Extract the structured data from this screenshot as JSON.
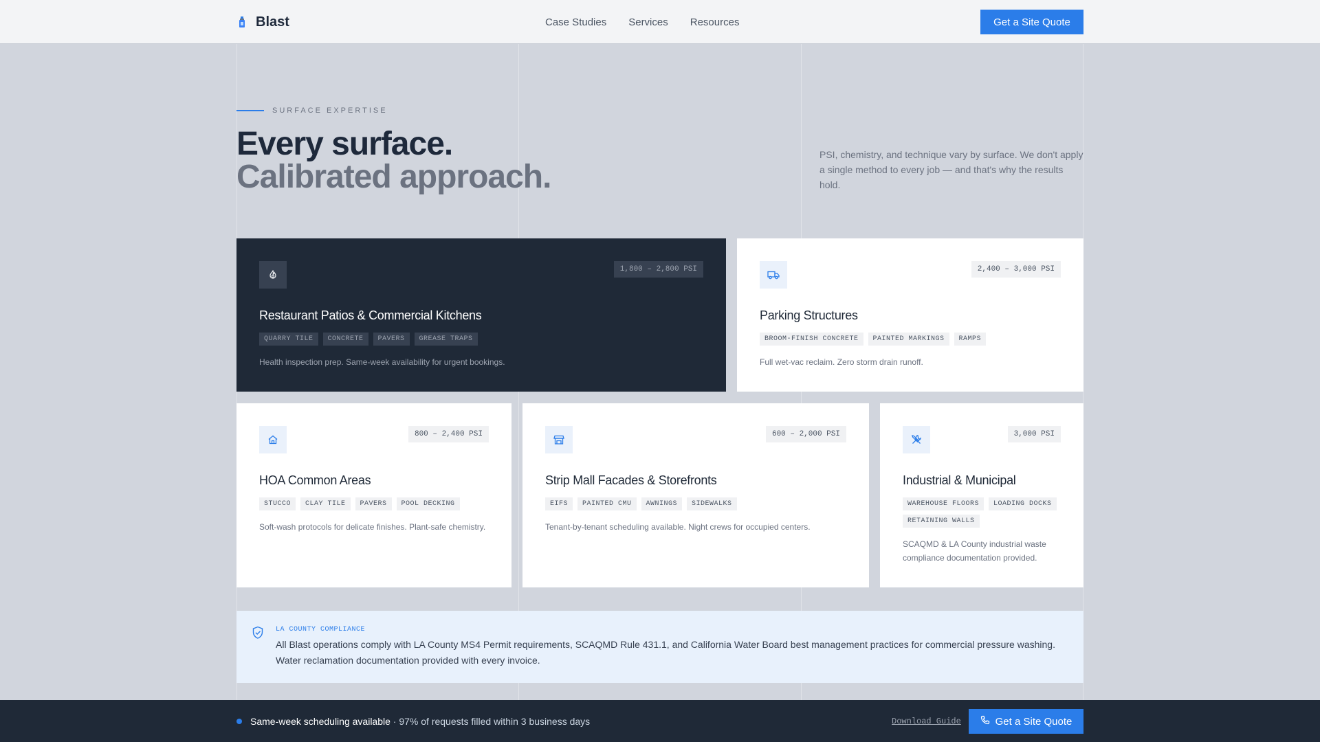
{
  "header": {
    "brand": "Blast",
    "nav": [
      "Case Studies",
      "Services",
      "Resources"
    ],
    "cta": "Get a Site Quote"
  },
  "hero": {
    "eyebrow": "SURFACE EXPERTISE",
    "title_line1": "Every surface.",
    "title_line2": "Calibrated approach.",
    "description": "PSI, chemistry, and technique vary by surface. We don't apply a single method to every job — and that's why the results hold."
  },
  "cards": [
    {
      "title": "Restaurant Patios & Commercial Kitchens",
      "psi": "1,800 – 2,800 PSI",
      "icon": "flame-icon",
      "tags": [
        "QUARRY TILE",
        "CONCRETE",
        "PAVERS",
        "GREASE TRAPS"
      ],
      "desc": "Health inspection prep. Same-week availability for urgent bookings.",
      "theme": "dark"
    },
    {
      "title": "Parking Structures",
      "psi": "2,400 – 3,000 PSI",
      "icon": "truck-icon",
      "tags": [
        "BROOM-FINISH CONCRETE",
        "PAINTED MARKINGS",
        "RAMPS"
      ],
      "desc": "Full wet-vac reclaim. Zero storm drain runoff.",
      "theme": "light"
    },
    {
      "title": "HOA Common Areas",
      "psi": "800 – 2,400 PSI",
      "icon": "home-icon",
      "tags": [
        "STUCCO",
        "CLAY TILE",
        "PAVERS",
        "POOL DECKING"
      ],
      "desc": "Soft-wash protocols for delicate finishes. Plant-safe chemistry.",
      "theme": "light"
    },
    {
      "title": "Strip Mall Facades & Storefronts",
      "psi": "600 – 2,000 PSI",
      "icon": "storefront-icon",
      "tags": [
        "EIFS",
        "PAINTED CMU",
        "AWNINGS",
        "SIDEWALKS"
      ],
      "desc": "Tenant-by-tenant scheduling available. Night crews for occupied centers.",
      "theme": "light"
    },
    {
      "title": "Industrial & Municipal",
      "psi": "3,000 PSI",
      "icon": "tools-icon",
      "tags": [
        "WAREHOUSE FLOORS",
        "LOADING DOCKS",
        "RETAINING WALLS"
      ],
      "desc": "SCAQMD & LA County industrial waste compliance documentation provided.",
      "theme": "light"
    }
  ],
  "compliance": {
    "label": "LA COUNTY COMPLIANCE",
    "body": "All Blast operations comply with LA County MS4 Permit requirements, SCAQMD Rule 431.1, and California Water Board best management practices for commercial pressure washing. Water reclamation documentation provided with every invoice."
  },
  "bottombar": {
    "status_strong": "Same-week scheduling available",
    "status_rest": " · 97% of requests filled within 3 business days",
    "guide_link": "Download Guide",
    "cta": "Get a Site Quote"
  },
  "colors": {
    "accent": "#2b7de9",
    "dark": "#1f2937",
    "background": "#d1d5dd"
  }
}
